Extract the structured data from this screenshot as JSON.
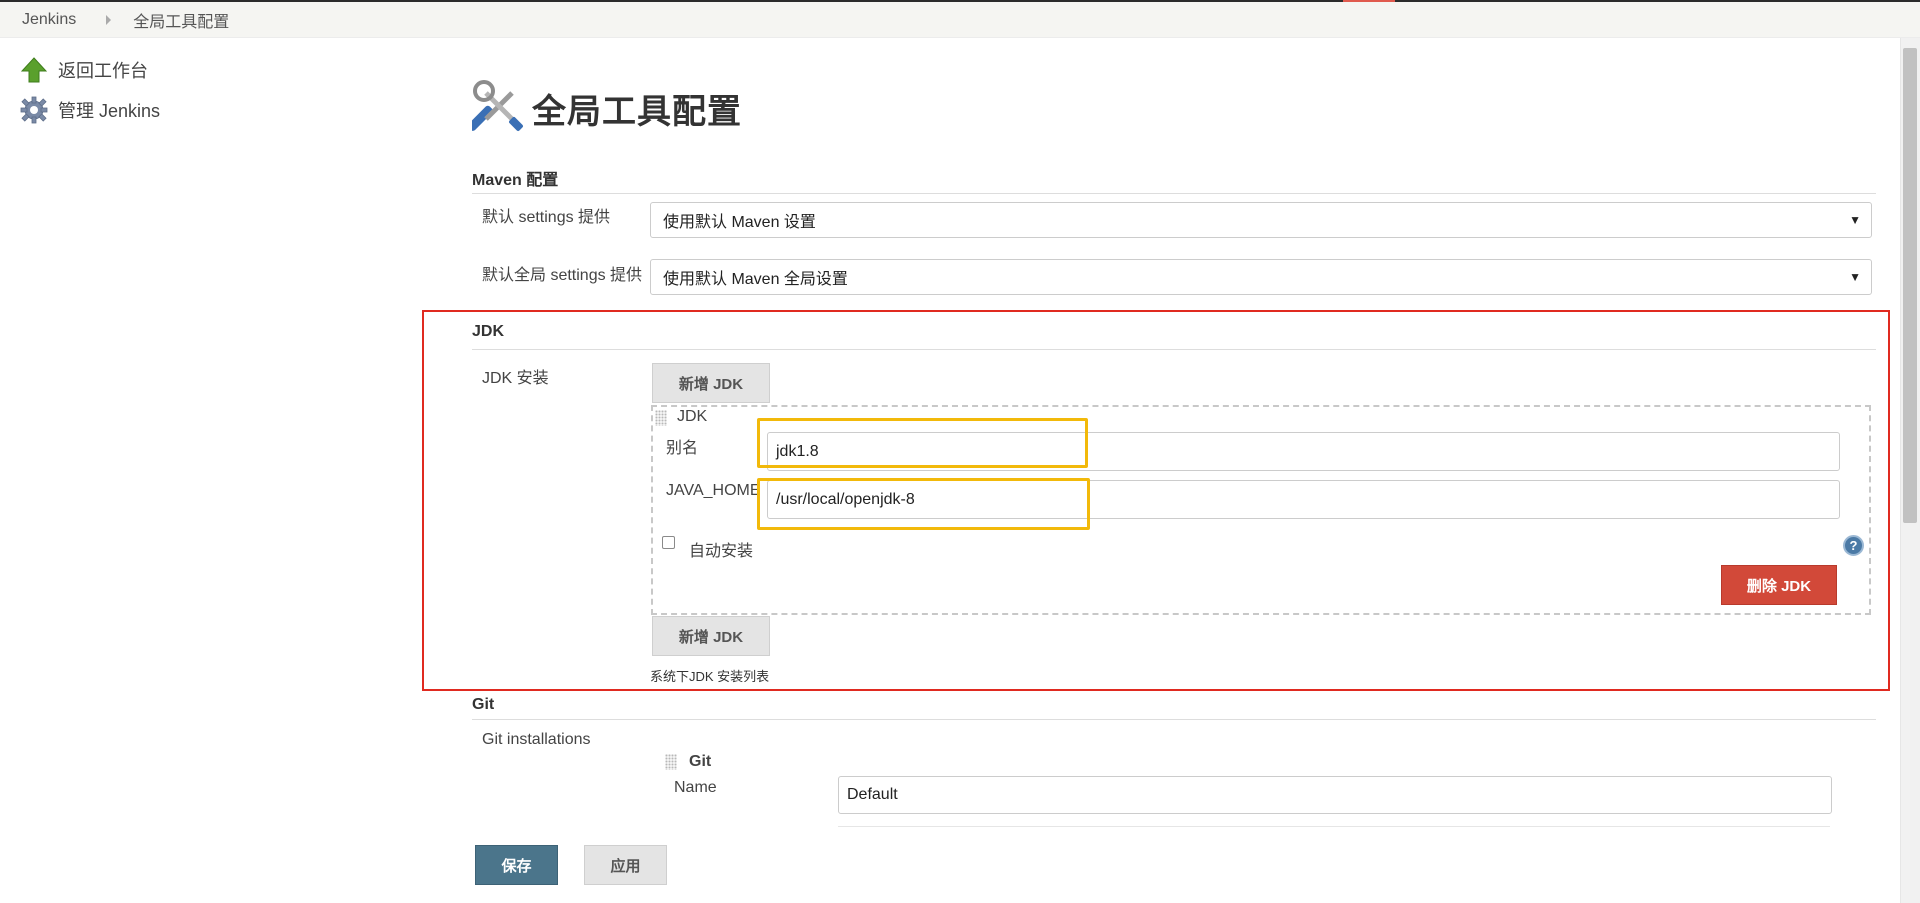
{
  "breadcrumb": {
    "items": [
      "Jenkins",
      "全局工具配置"
    ]
  },
  "sidebar": {
    "items": [
      {
        "label": "返回工作台",
        "icon": "up-arrow-icon"
      },
      {
        "label": "管理 Jenkins",
        "icon": "gear-icon"
      }
    ]
  },
  "page": {
    "title": "全局工具配置",
    "icon": "tools-icon"
  },
  "maven": {
    "header": "Maven 配置",
    "settings_label": "默认 settings 提供",
    "settings_value": "使用默认 Maven 设置",
    "global_settings_label": "默认全局 settings 提供",
    "global_settings_value": "使用默认 Maven 全局设置"
  },
  "jdk": {
    "header": "JDK",
    "install_label": "JDK 安装",
    "add_button": "新增 JDK",
    "entry_title": "JDK",
    "alias_label": "别名",
    "alias_value": "jdk1.8",
    "java_home_label": "JAVA_HOME",
    "java_home_value": "/usr/local/openjdk-8",
    "auto_install_label": "自动安装",
    "auto_install_checked": false,
    "delete_button": "删除 JDK",
    "add_button_bottom": "新增 JDK",
    "note": "系统下JDK 安装列表"
  },
  "git": {
    "header": "Git",
    "installations_label": "Git installations",
    "entry_title": "Git",
    "name_label": "Name",
    "name_value": "Default"
  },
  "footer": {
    "save_button": "保存",
    "apply_button": "应用"
  },
  "help_icon_glyph": "?",
  "colors": {
    "highlight_red": "#e02a20",
    "highlight_yellow": "#f2b90a",
    "delete_red": "#d24939",
    "save_blue": "#4b758b"
  }
}
